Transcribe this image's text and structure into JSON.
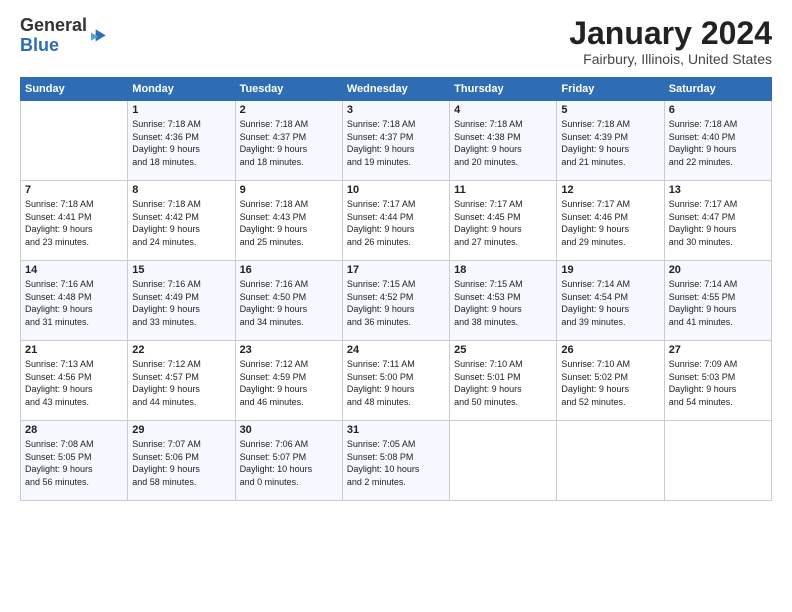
{
  "logo": {
    "general": "General",
    "blue": "Blue"
  },
  "title": "January 2024",
  "subtitle": "Fairbury, Illinois, United States",
  "headers": [
    "Sunday",
    "Monday",
    "Tuesday",
    "Wednesday",
    "Thursday",
    "Friday",
    "Saturday"
  ],
  "weeks": [
    [
      {
        "num": "",
        "lines": []
      },
      {
        "num": "1",
        "lines": [
          "Sunrise: 7:18 AM",
          "Sunset: 4:36 PM",
          "Daylight: 9 hours",
          "and 18 minutes."
        ]
      },
      {
        "num": "2",
        "lines": [
          "Sunrise: 7:18 AM",
          "Sunset: 4:37 PM",
          "Daylight: 9 hours",
          "and 18 minutes."
        ]
      },
      {
        "num": "3",
        "lines": [
          "Sunrise: 7:18 AM",
          "Sunset: 4:37 PM",
          "Daylight: 9 hours",
          "and 19 minutes."
        ]
      },
      {
        "num": "4",
        "lines": [
          "Sunrise: 7:18 AM",
          "Sunset: 4:38 PM",
          "Daylight: 9 hours",
          "and 20 minutes."
        ]
      },
      {
        "num": "5",
        "lines": [
          "Sunrise: 7:18 AM",
          "Sunset: 4:39 PM",
          "Daylight: 9 hours",
          "and 21 minutes."
        ]
      },
      {
        "num": "6",
        "lines": [
          "Sunrise: 7:18 AM",
          "Sunset: 4:40 PM",
          "Daylight: 9 hours",
          "and 22 minutes."
        ]
      }
    ],
    [
      {
        "num": "7",
        "lines": [
          "Sunrise: 7:18 AM",
          "Sunset: 4:41 PM",
          "Daylight: 9 hours",
          "and 23 minutes."
        ]
      },
      {
        "num": "8",
        "lines": [
          "Sunrise: 7:18 AM",
          "Sunset: 4:42 PM",
          "Daylight: 9 hours",
          "and 24 minutes."
        ]
      },
      {
        "num": "9",
        "lines": [
          "Sunrise: 7:18 AM",
          "Sunset: 4:43 PM",
          "Daylight: 9 hours",
          "and 25 minutes."
        ]
      },
      {
        "num": "10",
        "lines": [
          "Sunrise: 7:17 AM",
          "Sunset: 4:44 PM",
          "Daylight: 9 hours",
          "and 26 minutes."
        ]
      },
      {
        "num": "11",
        "lines": [
          "Sunrise: 7:17 AM",
          "Sunset: 4:45 PM",
          "Daylight: 9 hours",
          "and 27 minutes."
        ]
      },
      {
        "num": "12",
        "lines": [
          "Sunrise: 7:17 AM",
          "Sunset: 4:46 PM",
          "Daylight: 9 hours",
          "and 29 minutes."
        ]
      },
      {
        "num": "13",
        "lines": [
          "Sunrise: 7:17 AM",
          "Sunset: 4:47 PM",
          "Daylight: 9 hours",
          "and 30 minutes."
        ]
      }
    ],
    [
      {
        "num": "14",
        "lines": [
          "Sunrise: 7:16 AM",
          "Sunset: 4:48 PM",
          "Daylight: 9 hours",
          "and 31 minutes."
        ]
      },
      {
        "num": "15",
        "lines": [
          "Sunrise: 7:16 AM",
          "Sunset: 4:49 PM",
          "Daylight: 9 hours",
          "and 33 minutes."
        ]
      },
      {
        "num": "16",
        "lines": [
          "Sunrise: 7:16 AM",
          "Sunset: 4:50 PM",
          "Daylight: 9 hours",
          "and 34 minutes."
        ]
      },
      {
        "num": "17",
        "lines": [
          "Sunrise: 7:15 AM",
          "Sunset: 4:52 PM",
          "Daylight: 9 hours",
          "and 36 minutes."
        ]
      },
      {
        "num": "18",
        "lines": [
          "Sunrise: 7:15 AM",
          "Sunset: 4:53 PM",
          "Daylight: 9 hours",
          "and 38 minutes."
        ]
      },
      {
        "num": "19",
        "lines": [
          "Sunrise: 7:14 AM",
          "Sunset: 4:54 PM",
          "Daylight: 9 hours",
          "and 39 minutes."
        ]
      },
      {
        "num": "20",
        "lines": [
          "Sunrise: 7:14 AM",
          "Sunset: 4:55 PM",
          "Daylight: 9 hours",
          "and 41 minutes."
        ]
      }
    ],
    [
      {
        "num": "21",
        "lines": [
          "Sunrise: 7:13 AM",
          "Sunset: 4:56 PM",
          "Daylight: 9 hours",
          "and 43 minutes."
        ]
      },
      {
        "num": "22",
        "lines": [
          "Sunrise: 7:12 AM",
          "Sunset: 4:57 PM",
          "Daylight: 9 hours",
          "and 44 minutes."
        ]
      },
      {
        "num": "23",
        "lines": [
          "Sunrise: 7:12 AM",
          "Sunset: 4:59 PM",
          "Daylight: 9 hours",
          "and 46 minutes."
        ]
      },
      {
        "num": "24",
        "lines": [
          "Sunrise: 7:11 AM",
          "Sunset: 5:00 PM",
          "Daylight: 9 hours",
          "and 48 minutes."
        ]
      },
      {
        "num": "25",
        "lines": [
          "Sunrise: 7:10 AM",
          "Sunset: 5:01 PM",
          "Daylight: 9 hours",
          "and 50 minutes."
        ]
      },
      {
        "num": "26",
        "lines": [
          "Sunrise: 7:10 AM",
          "Sunset: 5:02 PM",
          "Daylight: 9 hours",
          "and 52 minutes."
        ]
      },
      {
        "num": "27",
        "lines": [
          "Sunrise: 7:09 AM",
          "Sunset: 5:03 PM",
          "Daylight: 9 hours",
          "and 54 minutes."
        ]
      }
    ],
    [
      {
        "num": "28",
        "lines": [
          "Sunrise: 7:08 AM",
          "Sunset: 5:05 PM",
          "Daylight: 9 hours",
          "and 56 minutes."
        ]
      },
      {
        "num": "29",
        "lines": [
          "Sunrise: 7:07 AM",
          "Sunset: 5:06 PM",
          "Daylight: 9 hours",
          "and 58 minutes."
        ]
      },
      {
        "num": "30",
        "lines": [
          "Sunrise: 7:06 AM",
          "Sunset: 5:07 PM",
          "Daylight: 10 hours",
          "and 0 minutes."
        ]
      },
      {
        "num": "31",
        "lines": [
          "Sunrise: 7:05 AM",
          "Sunset: 5:08 PM",
          "Daylight: 10 hours",
          "and 2 minutes."
        ]
      },
      {
        "num": "",
        "lines": []
      },
      {
        "num": "",
        "lines": []
      },
      {
        "num": "",
        "lines": []
      }
    ]
  ]
}
